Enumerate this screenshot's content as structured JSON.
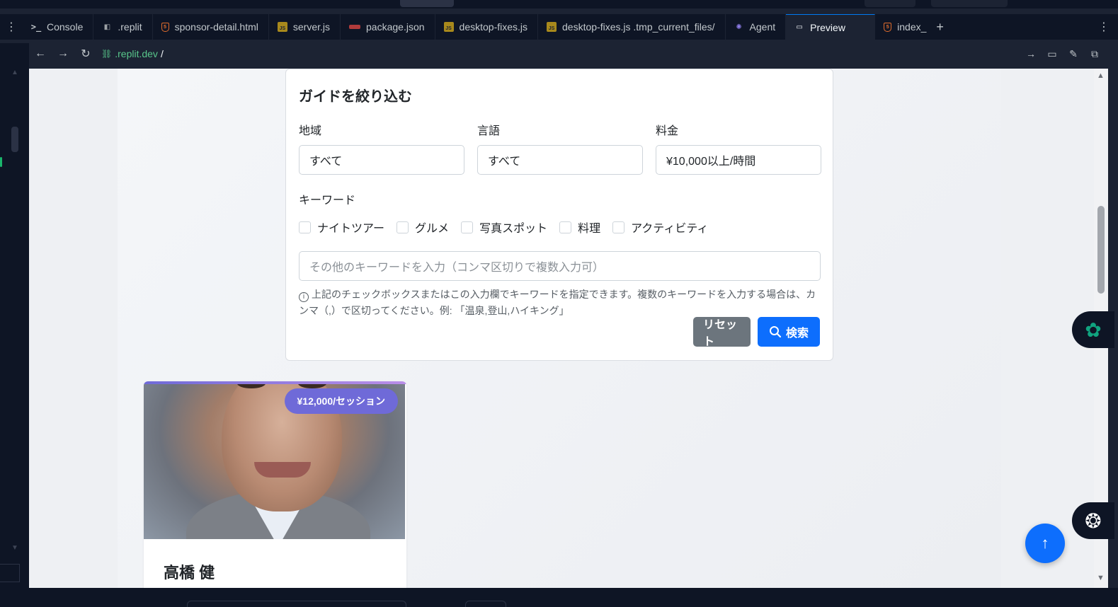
{
  "tabs": [
    {
      "label": "Console",
      "icon": "terminal-icon"
    },
    {
      "label": ".replit",
      "icon": "replit-icon"
    },
    {
      "label": "sponsor-detail.html",
      "icon": "html-file-icon"
    },
    {
      "label": "server.js",
      "icon": "js-file-icon"
    },
    {
      "label": "package.json",
      "icon": "json-file-icon"
    },
    {
      "label": "desktop-fixes.js",
      "icon": "js-file-icon"
    },
    {
      "label": "desktop-fixes.js .tmp_current_files/",
      "icon": "js-file-icon"
    },
    {
      "label": "Agent",
      "icon": "agent-icon"
    },
    {
      "label": "Preview",
      "icon": "preview-icon",
      "active": true
    },
    {
      "label": "index_",
      "icon": "html-file-icon"
    }
  ],
  "address": {
    "url": ".replit.dev",
    "slash": "/"
  },
  "filter": {
    "title": "ガイドを絞り込む",
    "region_label": "地域",
    "region_value": "すべて",
    "language_label": "言語",
    "language_value": "すべて",
    "price_label": "料金",
    "price_value": "¥10,000以上/時間",
    "keyword_label": "キーワード",
    "checkboxes": [
      {
        "label": "ナイトツアー",
        "checked": false
      },
      {
        "label": "グルメ",
        "checked": false
      },
      {
        "label": "写真スポット",
        "checked": false
      },
      {
        "label": "料理",
        "checked": false
      },
      {
        "label": "アクティビティ",
        "checked": false
      }
    ],
    "keyword_placeholder": "その他のキーワードを入力（コンマ区切りで複数入力可）",
    "hint": "上記のチェックボックスまたはこの入力欄でキーワードを指定できます。複数のキーワードを入力する場合は、カンマ（,）で区切ってください。例: 「温泉,登山,ハイキング」",
    "reset_label": "リセット",
    "search_label": "検索"
  },
  "guide": {
    "price": "¥12,000/セッション",
    "name": "高橋 健"
  },
  "colors": {
    "primary": "#0d6efd",
    "secondary": "#6c757d",
    "badge": "#6f6ad8",
    "url_green": "#58c68b"
  }
}
